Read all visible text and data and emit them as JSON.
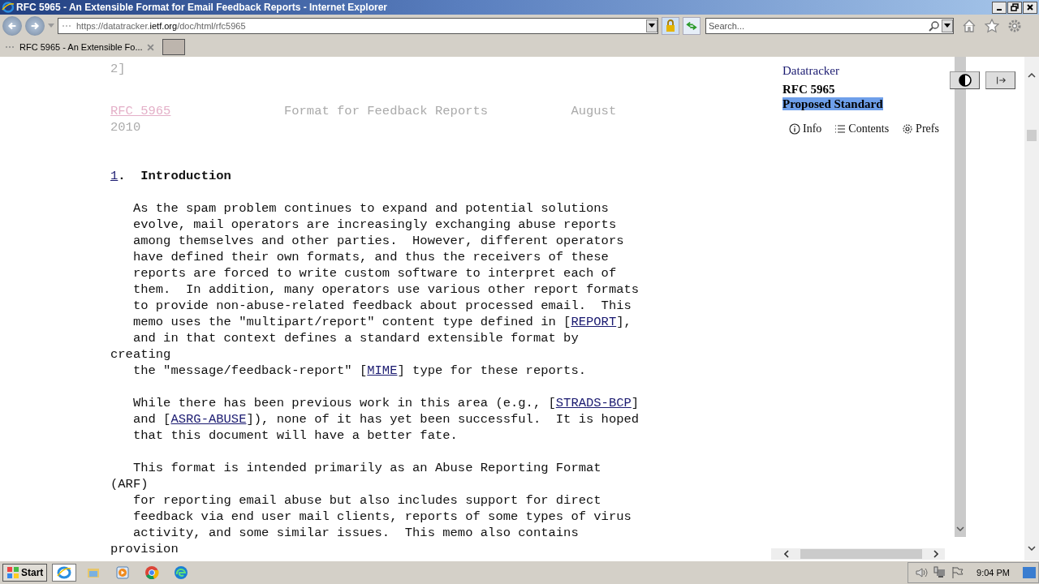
{
  "window": {
    "title": "RFC 5965 - An Extensible Format for Email Feedback Reports - Internet Explorer"
  },
  "address_bar": {
    "scheme": "https://",
    "host_pre": "datatracker.",
    "host": "ietf.org",
    "path": "/doc/html/rfc5965"
  },
  "search": {
    "placeholder": "Search..."
  },
  "tabs": [
    {
      "label": "RFC 5965 - An Extensible Fo...",
      "selected": true
    }
  ],
  "document": {
    "blocks": [
      {
        "kind": "page-end",
        "lines": [
          [
            {
              "text": "2]",
              "link": false
            }
          ]
        ]
      },
      {
        "kind": "header",
        "lines": [
          [
            {
              "text": "RFC 5965",
              "link": true
            },
            {
              "text": "               Format for Feedback Reports           August",
              "link": false
            }
          ],
          [
            {
              "text": "2010",
              "link": false
            }
          ]
        ]
      },
      {
        "kind": "heading",
        "lines": [
          [
            {
              "text": "1",
              "link": true
            },
            {
              "text": ".  Introduction",
              "link": false
            }
          ]
        ]
      },
      {
        "kind": "para",
        "lines": [
          [
            {
              "text": "   As the spam problem continues to expand and potential solutions",
              "link": false
            }
          ],
          [
            {
              "text": "   evolve, mail operators are increasingly exchanging abuse reports",
              "link": false
            }
          ],
          [
            {
              "text": "   among themselves and other parties.  However, different operators",
              "link": false
            }
          ],
          [
            {
              "text": "   have defined their own formats, and thus the receivers of these",
              "link": false
            }
          ],
          [
            {
              "text": "   reports are forced to write custom software to interpret each of",
              "link": false
            }
          ],
          [
            {
              "text": "   them.  In addition, many operators use various other report formats",
              "link": false
            }
          ],
          [
            {
              "text": "   to provide non-abuse-related feedback about processed email.  This",
              "link": false
            }
          ],
          [
            {
              "text": "   memo uses the \"multipart/report\" content type defined in [",
              "link": false
            },
            {
              "text": "REPORT",
              "link": true
            },
            {
              "text": "],",
              "link": false
            }
          ],
          [
            {
              "text": "   and in that context defines a standard extensible format by",
              "link": false
            }
          ],
          [
            {
              "text": "creating",
              "link": false
            }
          ],
          [
            {
              "text": "   the \"message/feedback-report\" [",
              "link": false
            },
            {
              "text": "MIME",
              "link": true
            },
            {
              "text": "] type for these reports.",
              "link": false
            }
          ]
        ]
      },
      {
        "kind": "para",
        "lines": [
          [
            {
              "text": "   While there has been previous work in this area (e.g., [",
              "link": false
            },
            {
              "text": "STRADS-BCP",
              "link": true
            },
            {
              "text": "]",
              "link": false
            }
          ],
          [
            {
              "text": "   and [",
              "link": false
            },
            {
              "text": "ASRG-ABUSE",
              "link": true
            },
            {
              "text": "]), none of it has yet been successful.  It is hoped",
              "link": false
            }
          ],
          [
            {
              "text": "   that this document will have a better fate.",
              "link": false
            }
          ]
        ]
      },
      {
        "kind": "para",
        "lines": [
          [
            {
              "text": "   This format is intended primarily as an Abuse Reporting Format",
              "link": false
            }
          ],
          [
            {
              "text": "(ARF)",
              "link": false
            }
          ],
          [
            {
              "text": "   for reporting email abuse but also includes support for direct",
              "link": false
            }
          ],
          [
            {
              "text": "   feedback via end user mail clients, reports of some types of virus",
              "link": false
            }
          ],
          [
            {
              "text": "   activity, and some similar issues.  This memo also contains",
              "link": false
            }
          ],
          [
            {
              "text": "provision",
              "link": false
            }
          ]
        ]
      }
    ]
  },
  "sidebar": {
    "site": "Datatracker",
    "doc": "RFC 5965",
    "status": {
      "text": "Proposed Standard",
      "selected": true
    },
    "links": [
      {
        "kind": "info",
        "label": "Info"
      },
      {
        "kind": "contents",
        "label": "Contents"
      },
      {
        "kind": "prefs",
        "label": "Prefs"
      }
    ]
  },
  "taskbar": {
    "start": "Start",
    "apps": [
      {
        "kind": "ie",
        "selected": true
      },
      {
        "kind": "folder",
        "selected": false
      },
      {
        "kind": "media",
        "selected": false
      },
      {
        "kind": "chrome",
        "selected": false
      },
      {
        "kind": "edge",
        "selected": false
      }
    ],
    "clock": "9:04 PM"
  }
}
